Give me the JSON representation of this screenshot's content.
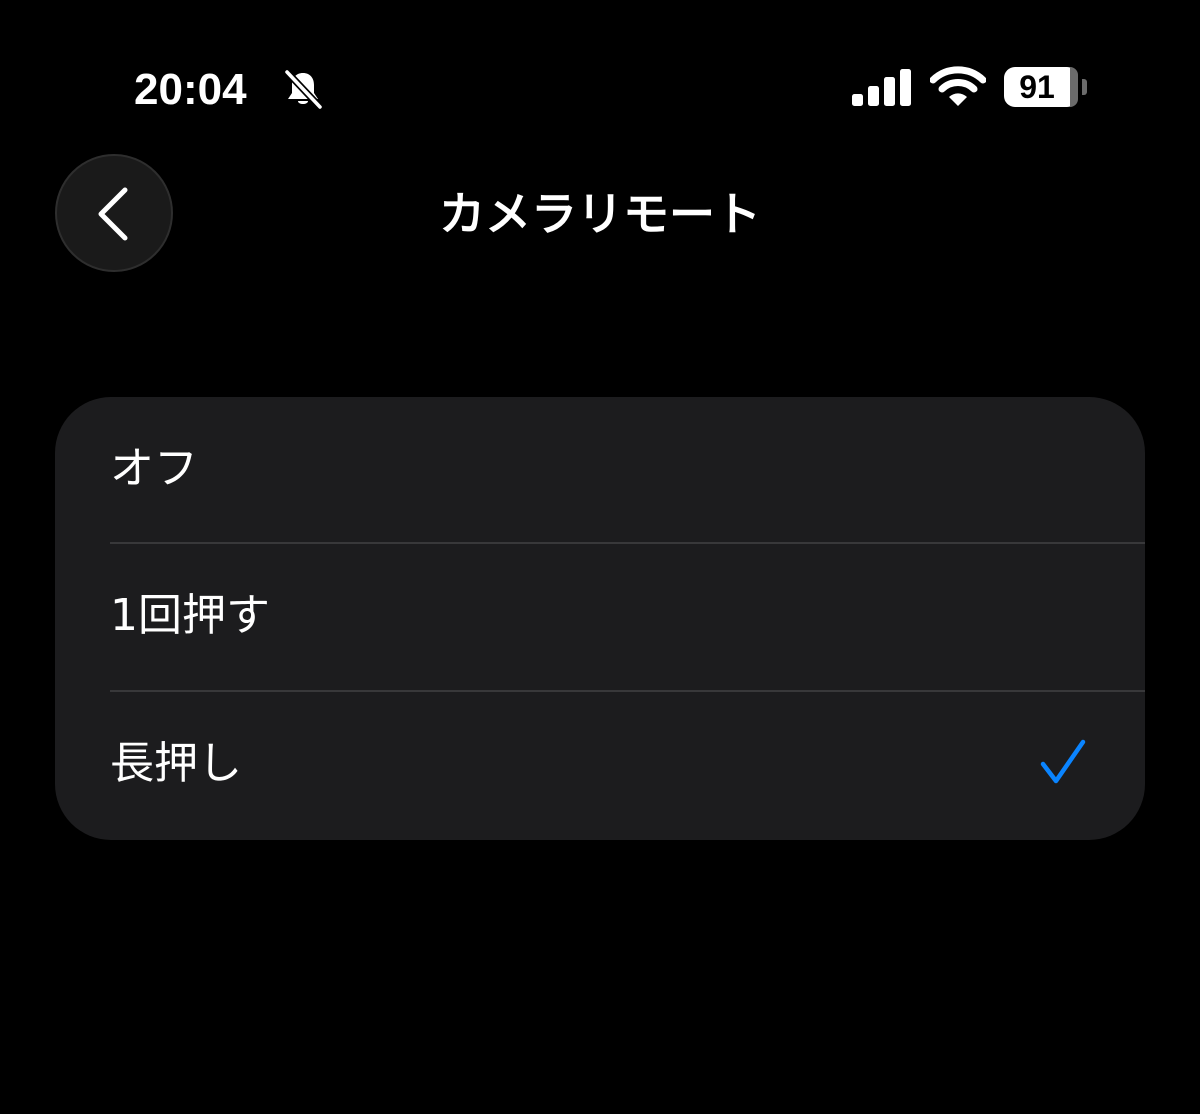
{
  "status_bar": {
    "time": "20:04",
    "battery_level": "91",
    "icons": [
      "bell-slash-icon",
      "cellular-signal-icon",
      "wifi-icon",
      "battery-icon"
    ]
  },
  "nav": {
    "back_icon": "chevron-left-icon",
    "title": "カメラリモート"
  },
  "options": {
    "items": [
      {
        "label": "オフ",
        "selected": false
      },
      {
        "label": "1回押す",
        "selected": false
      },
      {
        "label": "長押し",
        "selected": true
      }
    ],
    "check_icon": "checkmark-icon",
    "accent_color": "#0A84FF"
  },
  "colors": {
    "background": "#000000",
    "card": "#1C1C1E",
    "divider": "#38383A",
    "text": "#FFFFFF"
  }
}
